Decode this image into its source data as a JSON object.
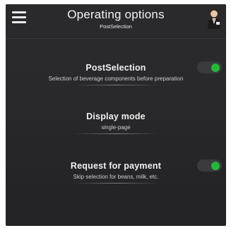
{
  "header": {
    "title": "Operating options",
    "subtitle": "PostSelection",
    "menu_icon": "hamburger-menu-icon",
    "user_icon": "user-avatar-icon"
  },
  "options": [
    {
      "label": "PostSelection",
      "description": "Selection of beverage components before preparation",
      "toggle_on": true
    },
    {
      "label": "Display mode",
      "value": "single-page"
    },
    {
      "label": "Request for payment",
      "description": "Skip selection for beans, milk, etc.",
      "toggle_on": true
    }
  ],
  "colors": {
    "background": "#262628",
    "toggle_track": "#3b3b3d",
    "toggle_on": "#22b83a",
    "text": "#f0f0f0"
  }
}
